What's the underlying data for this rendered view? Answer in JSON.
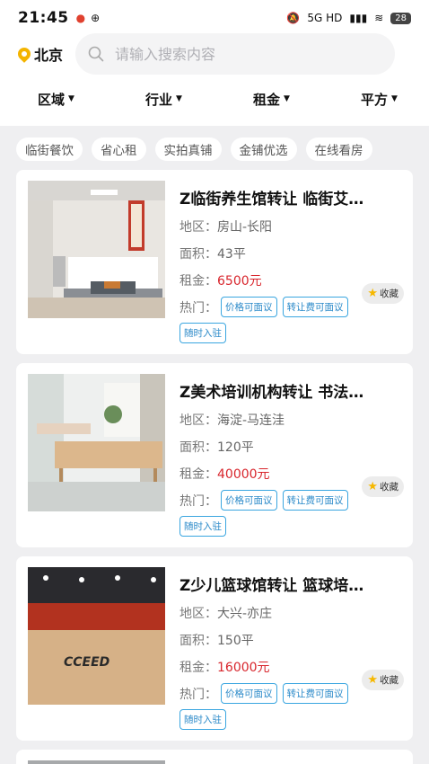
{
  "status": {
    "time": "21:45",
    "battery": "28",
    "network": "5G HD"
  },
  "header": {
    "city": "北京",
    "search_placeholder": "请输入搜索内容"
  },
  "filters": [
    "区域",
    "行业",
    "租金",
    "平方"
  ],
  "tags": [
    "临街餐饮",
    "省心租",
    "实拍真铺",
    "金铺优选",
    "在线看房"
  ],
  "listings": [
    {
      "title": "Z临街养生馆转让 临街艾…",
      "area_label": "地区：",
      "area": "房山-长阳",
      "size_label": "面积：",
      "size": "43平",
      "rent_label": "租金：",
      "rent": "6500元",
      "hot_label": "热门：",
      "chips": [
        "价格可面议",
        "转让费可面议",
        "随时入驻"
      ],
      "fav": "收藏"
    },
    {
      "title": "Z美术培训机构转让 书法…",
      "area_label": "地区：",
      "area": "海淀-马连洼",
      "size_label": "面积：",
      "size": "120平",
      "rent_label": "租金：",
      "rent": "40000元",
      "hot_label": "热门：",
      "chips": [
        "价格可面议",
        "转让费可面议",
        "随时入驻"
      ],
      "fav": "收藏"
    },
    {
      "title": "Z少儿篮球馆转让 篮球培…",
      "area_label": "地区：",
      "area": "大兴-亦庄",
      "size_label": "面积：",
      "size": "150平",
      "rent_label": "租金：",
      "rent": "16000元",
      "hot_label": "热门：",
      "chips": [
        "价格可面议",
        "转让费可面议",
        "随时入驻"
      ],
      "fav": "收藏"
    }
  ],
  "colors": {
    "accent": "#3aa6e0",
    "price": "#d8262d",
    "pin": "#f4b400"
  }
}
